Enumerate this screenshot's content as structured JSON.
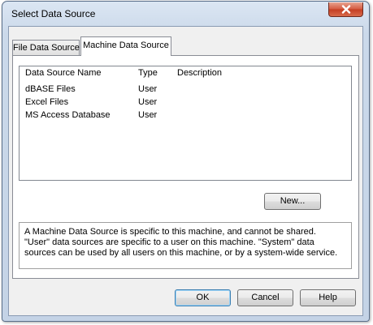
{
  "window": {
    "title": "Select Data Source"
  },
  "tabs": [
    {
      "label": "File Data Source",
      "selected": false
    },
    {
      "label": "Machine Data Source",
      "selected": true
    }
  ],
  "list": {
    "columns": [
      "Data Source Name",
      "Type",
      "Description"
    ],
    "rows": [
      {
        "name": "dBASE Files",
        "type": "User",
        "description": ""
      },
      {
        "name": "Excel Files",
        "type": "User",
        "description": ""
      },
      {
        "name": "MS Access Database",
        "type": "User",
        "description": ""
      }
    ]
  },
  "new_button": "New...",
  "description_text": "A Machine Data Source is specific to this machine, and cannot be shared.\n\"User\" data sources are specific to a user on this machine.  \"System\" data\nsources can be used by all users on this machine, or by a system-wide service.",
  "buttons": {
    "ok": "OK",
    "cancel": "Cancel",
    "help": "Help"
  },
  "icons": {
    "close": "close-icon"
  }
}
